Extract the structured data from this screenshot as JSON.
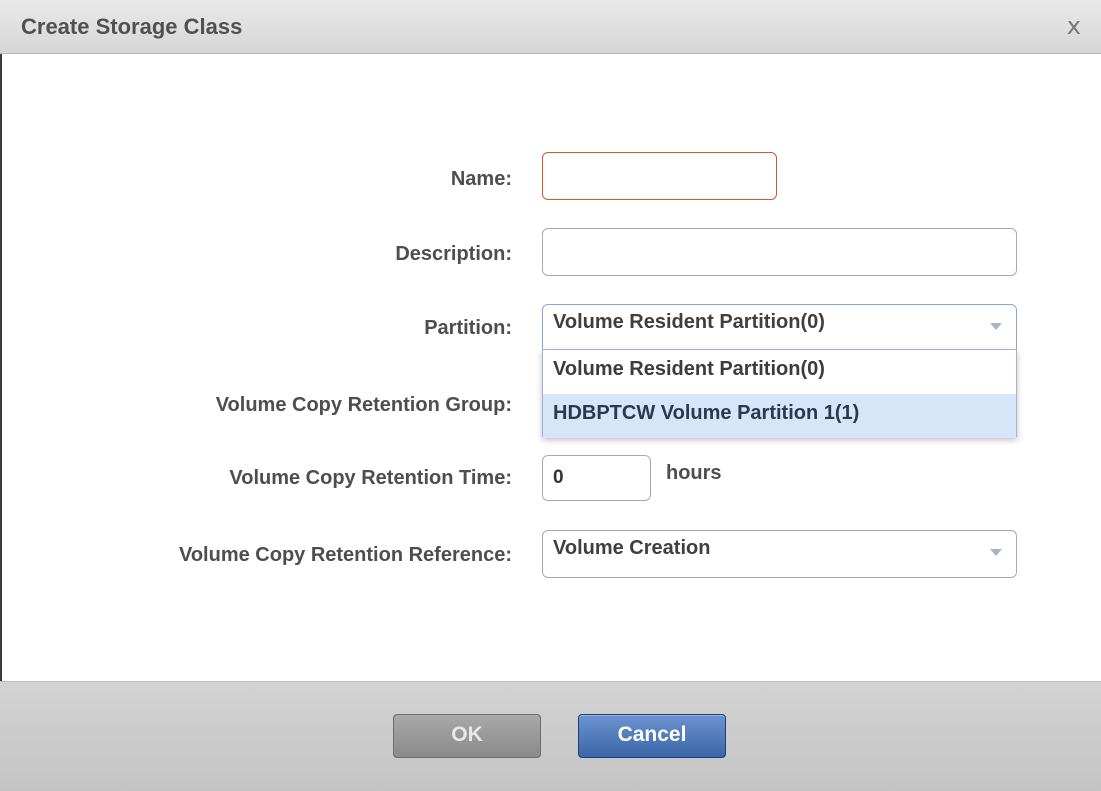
{
  "dialog": {
    "title": "Create Storage Class",
    "close_glyph": "x"
  },
  "form": {
    "name_label": "Name:",
    "name_value": "",
    "description_label": "Description:",
    "description_value": "",
    "partition_label": "Partition:",
    "partition_selected": "Volume Resident Partition(0)",
    "partition_options": [
      "Volume Resident Partition(0)",
      "HDBPTCW Volume Partition 1(1)"
    ],
    "partition_highlighted_index": 1,
    "retention_group_label": "Volume Copy Retention Group:",
    "retention_time_label": "Volume Copy Retention Time:",
    "retention_time_value": "0",
    "retention_time_unit": "hours",
    "retention_reference_label": "Volume Copy Retention Reference:",
    "retention_reference_selected": "Volume Creation"
  },
  "buttons": {
    "ok_label": "OK",
    "cancel_label": "Cancel"
  },
  "colors": {
    "required_border": "#cf5a2c",
    "highlight": "#d6e5f7",
    "primary_button": "#3a66a9",
    "disabled_button": "#8a8a8a"
  },
  "icons": {
    "close": "close-icon",
    "caret": "chevron-down-icon"
  }
}
